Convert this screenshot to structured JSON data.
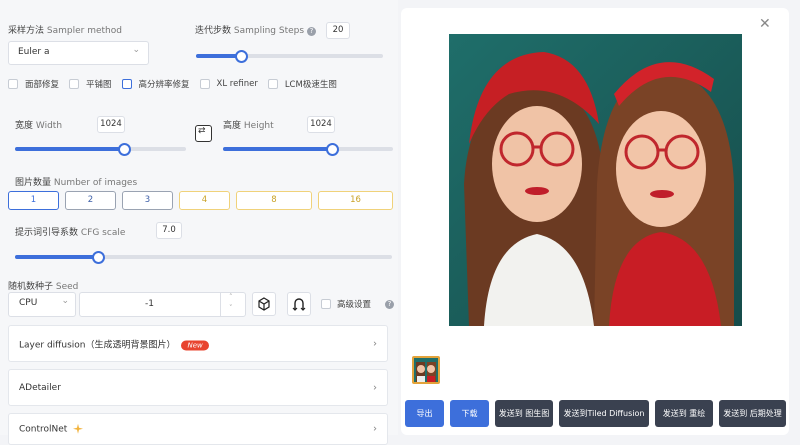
{
  "sampler": {
    "label_cn": "采样方法",
    "label_en": "Sampler method",
    "value": "Euler a"
  },
  "steps": {
    "label_cn": "迭代步数",
    "label_en": "Sampling Steps",
    "value": "20",
    "fraction": 0.24
  },
  "checkboxes": [
    {
      "label": "面部修复",
      "checked": false,
      "highlight": false
    },
    {
      "label": "平铺图",
      "checked": false,
      "highlight": false
    },
    {
      "label": "高分辨率修复",
      "checked": false,
      "highlight": true
    },
    {
      "label": "XL refiner",
      "checked": false,
      "highlight": false
    },
    {
      "label": "LCM极速生图",
      "checked": false,
      "highlight": false
    }
  ],
  "width": {
    "label_cn": "宽度",
    "label_en": "Width",
    "value": "1024",
    "fraction": 0.64
  },
  "height": {
    "label_cn": "高度",
    "label_en": "Height",
    "value": "1024",
    "fraction": 0.64
  },
  "num_images": {
    "label_cn": "图片数量",
    "label_en": "Number of images",
    "options": [
      "1",
      "2",
      "3",
      "4",
      "8",
      "16"
    ],
    "selected": "1"
  },
  "cfg": {
    "label_cn": "提示词引导系数",
    "label_en": "CFG scale",
    "value": "7.0",
    "fraction": 0.22
  },
  "seed": {
    "label_cn": "随机数种子",
    "label_en": "Seed",
    "device": "CPU",
    "value": "-1",
    "advanced_label": "高级设置"
  },
  "accordions": [
    {
      "label": "Layer diffusion（生成透明背景图片）",
      "badge": "New"
    },
    {
      "label": "ADetailer",
      "badge": ""
    },
    {
      "label": "ControlNet",
      "badge": ""
    }
  ],
  "actions": [
    {
      "label": "导出",
      "style": "blue"
    },
    {
      "label": "下载",
      "style": "blue"
    },
    {
      "label": "发送到 图生图",
      "style": "dark"
    },
    {
      "label": "发送到Tiled Diffusion",
      "style": "dark"
    },
    {
      "label": "发送到 重绘",
      "style": "dark"
    },
    {
      "label": "发送到 后期处理",
      "style": "dark"
    }
  ],
  "colors": {
    "accent": "#3d6fdb",
    "gold": "#c9a227",
    "dark_button": "#3a4150",
    "badge": "#e8442f"
  }
}
